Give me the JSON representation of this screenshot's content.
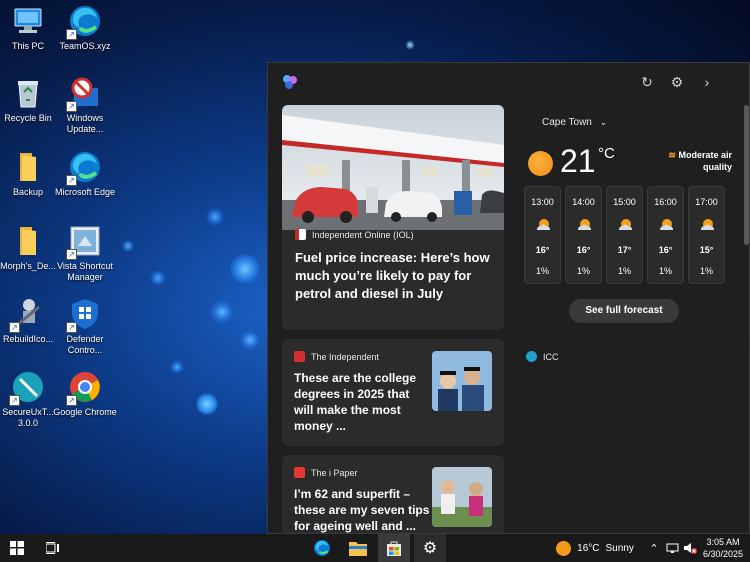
{
  "desktop": {
    "icons": [
      {
        "label": "This PC"
      },
      {
        "label": "TeamOS.xyz"
      },
      {
        "label": "Recycle Bin"
      },
      {
        "label": "Windows Update..."
      },
      {
        "label": "Backup"
      },
      {
        "label": "Microsoft Edge"
      },
      {
        "label": "Morph's_De..."
      },
      {
        "label": "Vista Shortcut Manager"
      },
      {
        "label": "RebuildIco..."
      },
      {
        "label": "Defender Contro..."
      },
      {
        "label": "SecureUxT... 3.0.0"
      },
      {
        "label": "Google Chrome"
      }
    ]
  },
  "widgets": {
    "hero": {
      "source": "Independent Online (IOL)",
      "headline": "Fuel price increase: Here’s how much you’re likely to pay for petrol and diesel in July",
      "slides": 19,
      "active_slide": 1
    },
    "weather": {
      "city": "Cape Town",
      "temp": "21",
      "unit": "°C",
      "air_quality": "Moderate air quality",
      "hours": [
        {
          "time": "13:00",
          "temp": "16°",
          "precip": "1%"
        },
        {
          "time": "14:00",
          "temp": "16°",
          "precip": "1%"
        },
        {
          "time": "15:00",
          "temp": "17°",
          "precip": "1%"
        },
        {
          "time": "16:00",
          "temp": "16°",
          "precip": "1%"
        },
        {
          "time": "17:00",
          "temp": "15°",
          "precip": "1%"
        }
      ],
      "forecast_button": "See full forecast"
    },
    "cards": [
      {
        "source": "The Independent",
        "headline": "These are the college degrees in 2025 that will make the most money ..."
      },
      {
        "source": "The i Paper",
        "headline": "I’m 62 and superfit – these are my seven tips for ageing well and ..."
      }
    ],
    "icc": {
      "source": "ICC"
    }
  },
  "taskbar": {
    "weather_temp": "16°C",
    "weather_text": "Sunny",
    "time": "3:05 AM",
    "date": "6/30/2025"
  },
  "colors": {
    "panel_bg": "#1f1f1f",
    "card_bg": "#2b2b2b",
    "sun": "#f39a1c"
  }
}
